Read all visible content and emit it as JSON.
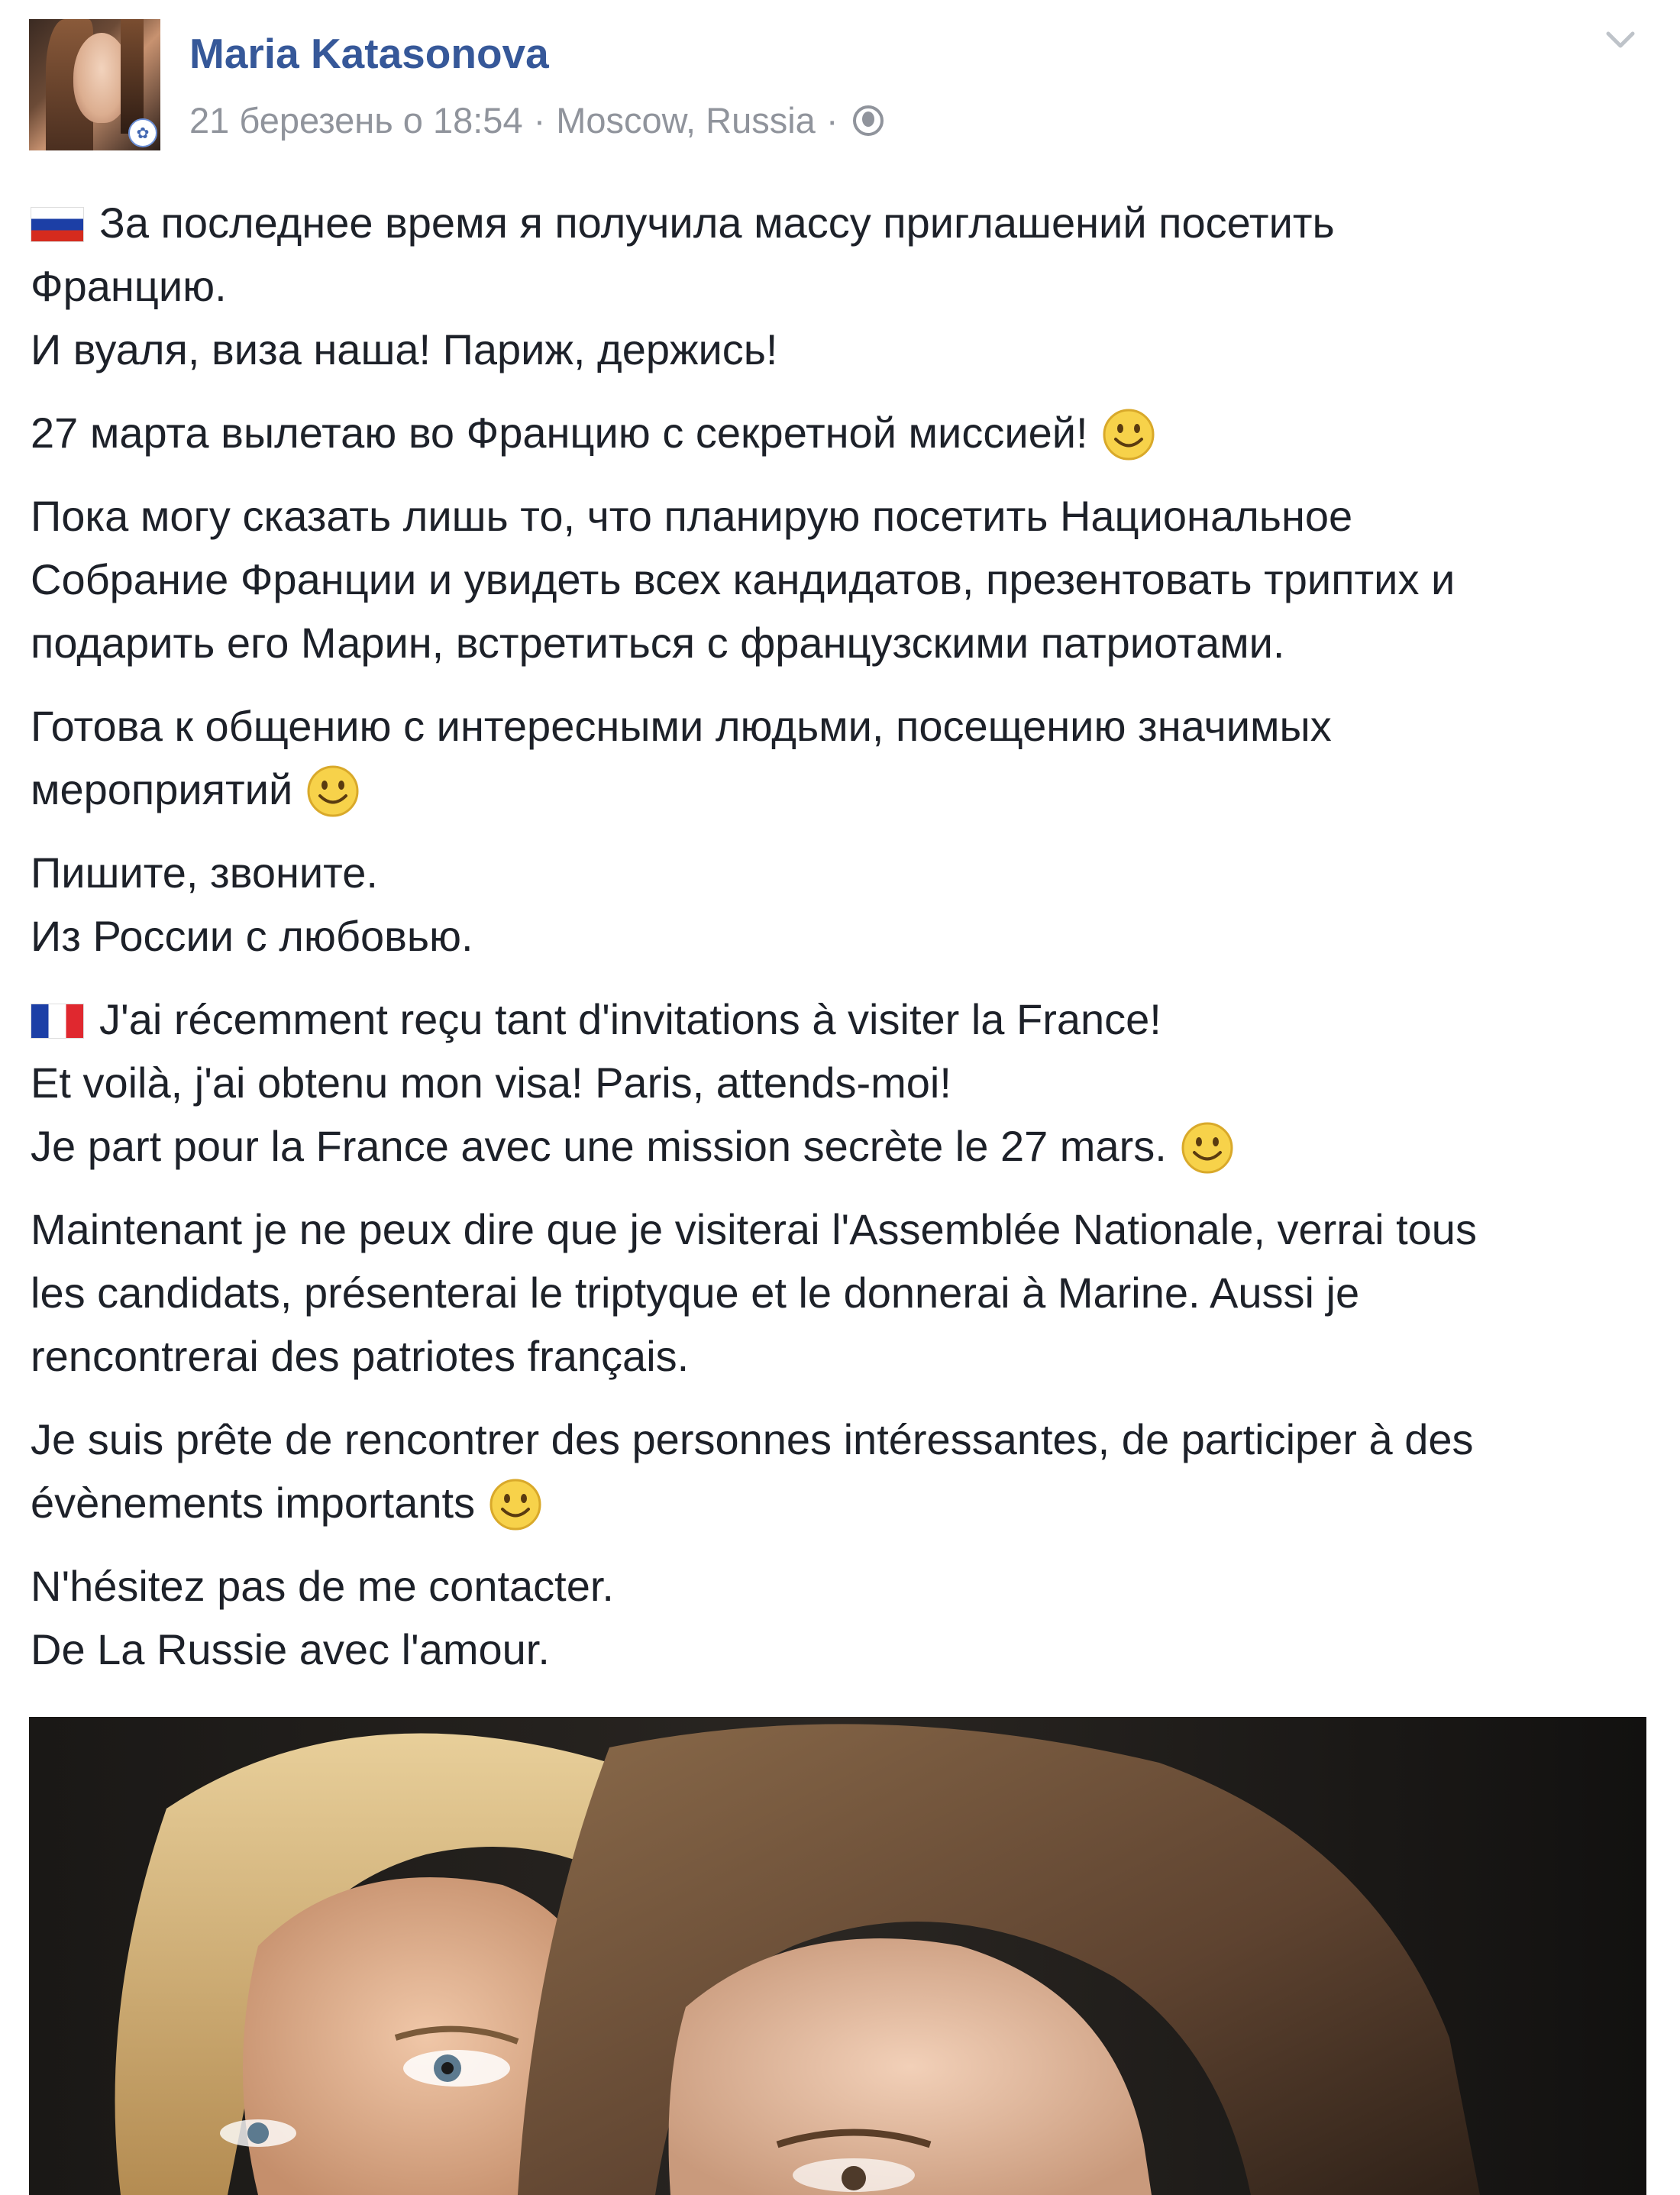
{
  "post": {
    "author_name": "Maria Katasonova",
    "date": "21 березень о 18:54",
    "location": "Moscow, Russia",
    "separator": "·",
    "privacy_icon": "globe-icon",
    "menu_icon": "chevron-down-icon",
    "avatar_badge_icon": "flower-icon"
  },
  "text": {
    "ru_p1_l1": "За последнее время я получила массу приглашений посетить",
    "ru_p1_l2": "Францию.",
    "ru_p1_l3": "И вуаля, виза наша! Париж, держись!",
    "ru_p2": "27 марта вылетаю во Францию с секретной миссией!",
    "ru_p3_l1": "Пока могу сказать лишь то, что планирую посетить Национальное",
    "ru_p3_l2": "Собрание Франции и увидеть всех кандидатов, презентовать триптих и",
    "ru_p3_l3": "подарить его Марин, встретиться с французскими патриотами.",
    "ru_p4_l1": "Готова к общению с интересными людьми, посещению значимых",
    "ru_p4_l2": "мероприятий",
    "ru_p5_l1": "Пишите, звоните.",
    "ru_p5_l2": "Из России с любовью.",
    "fr_p1_l1": "J'ai récemment reçu tant d'invitations à visiter la France!",
    "fr_p1_l2": "Et voilà, j'ai obtenu mon visa! Paris, attends-moi!",
    "fr_p1_l3": "Je part pour la France avec une mission secrète le 27 mars.",
    "fr_p2_l1": "Maintenant je ne peux dire que je visiterai l'Assemblée Nationale, verrai tous",
    "fr_p2_l2": "les candidats, présenterai le triptyque et le donnerai à Marine. Aussi je",
    "fr_p2_l3": "rencontrerai des patriotes français.",
    "fr_p3_l1": "Je suis prête de rencontrer des personnes intéressantes, de participer à des",
    "fr_p3_l2": "évènements importants",
    "fr_p4_l1": "N'hésitez pas de me contacter.",
    "fr_p4_l2": "De La Russie avec l'amour."
  },
  "icons": {
    "flag_ru": "russia-flag-icon",
    "flag_fr": "france-flag-icon",
    "emoji": "smiley-icon"
  },
  "colors": {
    "author_link": "#365899",
    "meta_text": "#90949c",
    "body_text": "#1d2129",
    "smiley_fill": "#f7d24a"
  }
}
